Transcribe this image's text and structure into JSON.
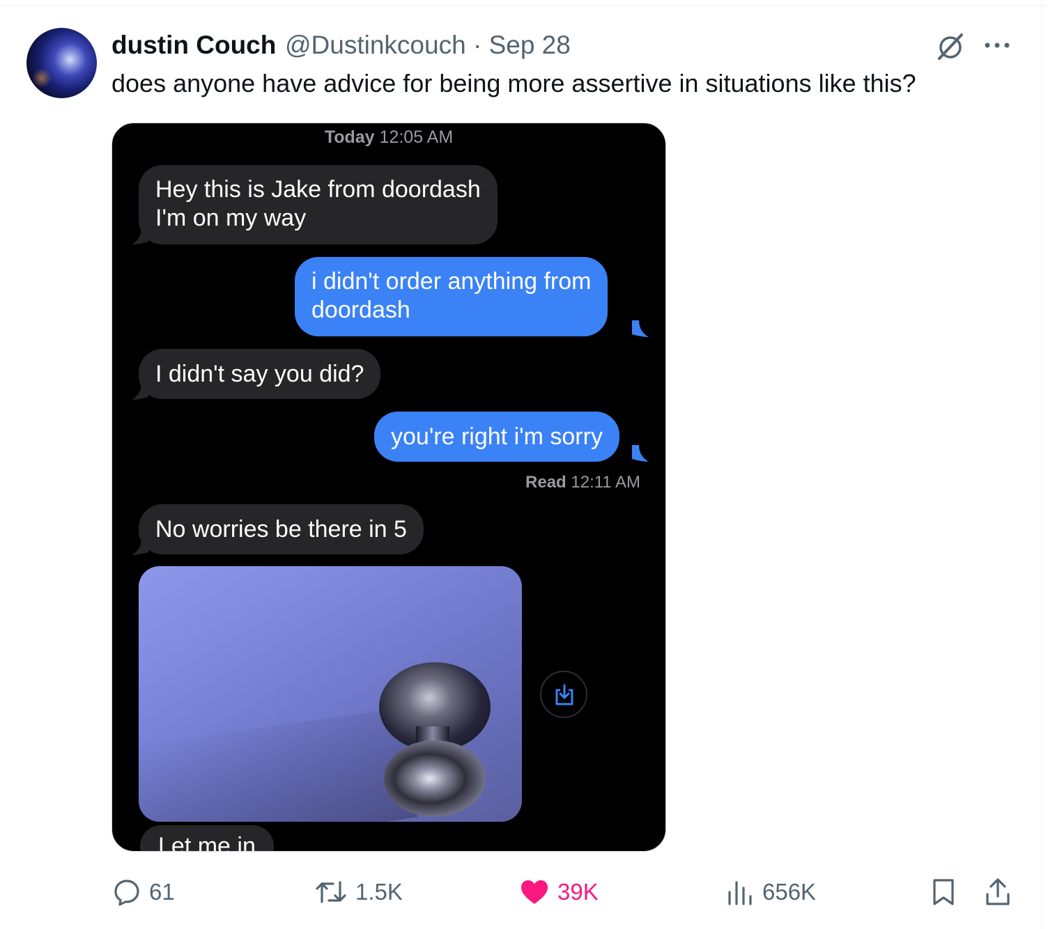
{
  "tweet": {
    "author_name": "dustin Couch",
    "handle": "@Dustinkcouch",
    "separator": "·",
    "date": "Sep 28",
    "text": "does anyone have advice for being more assertive in situations like this?"
  },
  "screenshot": {
    "timestamp_day": "Today",
    "timestamp_time": "12:05 AM",
    "messages": [
      {
        "side": "in",
        "lines": [
          "Hey this is Jake from doordash",
          "I'm on my way"
        ]
      },
      {
        "side": "out",
        "lines": [
          "i didn't order anything from",
          "doordash"
        ]
      },
      {
        "side": "in",
        "lines": [
          "I didn't say you did?"
        ]
      },
      {
        "side": "out",
        "lines": [
          "you're right i'm sorry"
        ]
      },
      {
        "side": "in",
        "lines": [
          "No worries be there in 5"
        ]
      },
      {
        "side": "in",
        "lines": [
          "Let me in"
        ]
      }
    ],
    "read_label": "Read",
    "read_time": "12:11 AM"
  },
  "actions": {
    "replies": "61",
    "reposts": "1.5K",
    "likes": "39K",
    "views": "656K"
  },
  "colors": {
    "outgoing_bubble": "#3b82f6",
    "incoming_bubble": "#262628",
    "like": "#f91880",
    "muted": "#536471"
  },
  "icons": [
    "grok-icon",
    "more-icon",
    "reply-icon",
    "repost-icon",
    "heart-icon",
    "views-icon",
    "bookmark-icon",
    "share-icon",
    "save-to-photos-icon"
  ]
}
